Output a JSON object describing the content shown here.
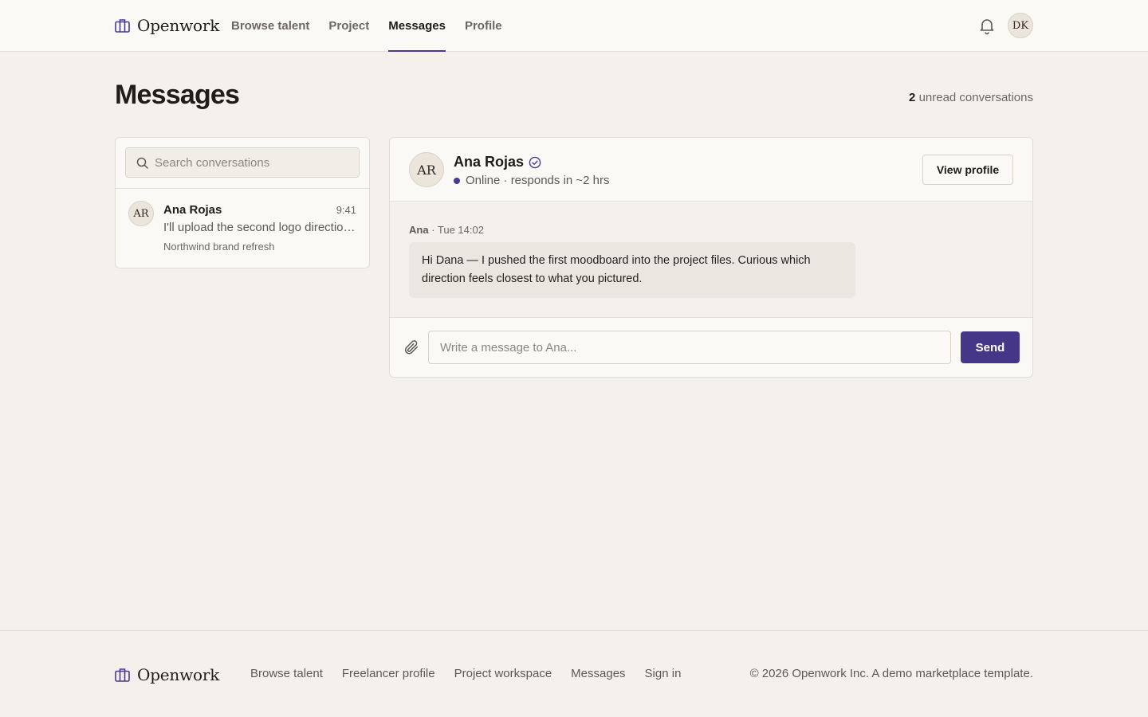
{
  "app": {
    "brand": "Openwork",
    "nav": [
      {
        "label": "Browse talent",
        "active": false
      },
      {
        "label": "Project",
        "active": false
      },
      {
        "label": "Messages",
        "active": true
      },
      {
        "label": "Profile",
        "active": false
      }
    ],
    "user_initials": "DK",
    "accent_color": "#463687"
  },
  "page": {
    "title": "Messages",
    "unread_count": "2",
    "unread_label": "unread conversations"
  },
  "sidebar": {
    "search_placeholder": "Search conversations",
    "conversations": [
      {
        "initials": "AR",
        "name": "Ana Rojas",
        "time": "9:41",
        "preview": "I'll upload the second logo direction by tomorrow morning.",
        "project": "Northwind brand refresh"
      }
    ]
  },
  "chat": {
    "initials": "AR",
    "name": "Ana Rojas",
    "status": "Online · responds in ~2 hrs",
    "view_profile_label": "View profile",
    "messages": [
      {
        "sender": "Ana",
        "time": "· Tue 14:02",
        "text": "Hi Dana — I pushed the first moodboard into the project files. Curious which direction feels closest to what you pictured."
      }
    ],
    "composer_placeholder": "Write a message to Ana...",
    "send_label": "Send"
  },
  "footer": {
    "brand": "Openwork",
    "links": [
      "Browse talent",
      "Freelancer profile",
      "Project workspace",
      "Messages",
      "Sign in"
    ],
    "copyright": "© 2026 Openwork Inc. A demo marketplace template."
  }
}
